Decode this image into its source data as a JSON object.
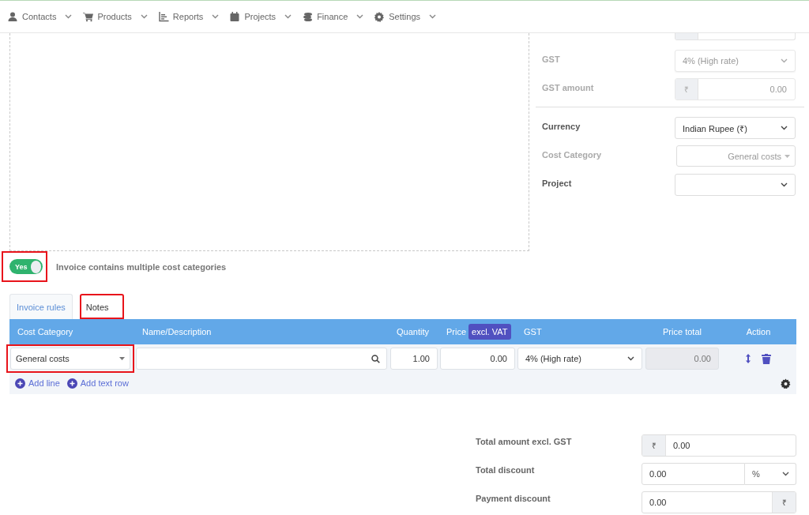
{
  "nav": {
    "items": [
      {
        "label": "Contacts"
      },
      {
        "label": "Products"
      },
      {
        "label": "Reports"
      },
      {
        "label": "Projects"
      },
      {
        "label": "Finance"
      },
      {
        "label": "Settings"
      }
    ]
  },
  "details": {
    "tax_fields": [
      {
        "label": "GST",
        "kind": "select",
        "value": "4% (High rate)",
        "disabled": true
      },
      {
        "label": "GST amount",
        "kind": "currency",
        "prefix": "₹",
        "value": "0.00",
        "disabled": true
      }
    ],
    "fields": [
      {
        "label": "Currency",
        "kind": "select",
        "value": "Indian Rupee (₹)",
        "disabled": false
      },
      {
        "label": "Cost Category",
        "kind": "combo",
        "value": "General costs",
        "disabled": true
      },
      {
        "label": "Project",
        "kind": "select",
        "disabled": false
      }
    ]
  },
  "cost_toggle": {
    "on": true,
    "text": "Yes",
    "label": "Invoice contains multiple cost categories",
    "highlighted": true
  },
  "tabs": [
    {
      "label": "Invoice rules",
      "selected": true,
      "highlighted": false
    },
    {
      "label": "Notes",
      "selected": false,
      "highlighted": true
    }
  ],
  "table": {
    "columns": [
      {
        "label": "Cost Category"
      },
      {
        "label": "Name/Description"
      },
      {
        "label": "Quantity"
      },
      {
        "label": "Price",
        "badge": "excl. VAT"
      },
      {
        "label": "GST"
      },
      {
        "label": "Price total"
      },
      {
        "label": "Action"
      }
    ],
    "rows": [
      {
        "cost_category": "General costs",
        "cost_category_highlighted": true,
        "quantity": "1.00",
        "price": "0.00",
        "gst": "4% (High rate)",
        "total": "0.00"
      }
    ],
    "actions": [
      "Add line",
      "Add text row"
    ]
  },
  "totals": [
    {
      "label": "Total amount excl. GST",
      "kind": "prefix",
      "unit": "₹",
      "value": "0.00"
    },
    {
      "label": "Total discount",
      "kind": "select-suffix",
      "unit": "%",
      "value": "0.00"
    },
    {
      "label": "Payment discount",
      "kind": "suffix",
      "unit": "₹",
      "value": "0.00"
    }
  ]
}
